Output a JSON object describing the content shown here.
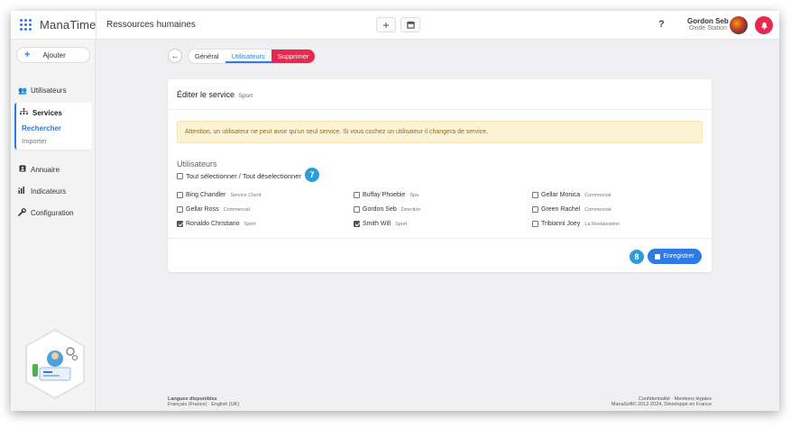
{
  "app": {
    "name": "ManaTime",
    "page_title": "Ressources humaines"
  },
  "topbar": {
    "add_icon": "+",
    "calendar_icon": "calendar-icon",
    "help": "?",
    "user_name": "Gordon Seb",
    "user_org": "Oxide Station"
  },
  "sidebar": {
    "add_label": "Ajouter",
    "items": [
      {
        "label": "Utilisateurs",
        "icon": "users-icon"
      },
      {
        "label": "Services",
        "icon": "sitemap-icon"
      },
      {
        "label": "Annuaire",
        "icon": "addressbook-icon"
      },
      {
        "label": "Indicateurs",
        "icon": "chart-icon"
      },
      {
        "label": "Configuration",
        "icon": "wrench-icon"
      }
    ],
    "services_sub": [
      "Rechercher",
      "Importer"
    ]
  },
  "tabs": [
    {
      "label": "Général"
    },
    {
      "label": "Utilisateurs"
    },
    {
      "label": "Supprimer"
    }
  ],
  "card": {
    "title": "Éditer le service",
    "service_name": "Sport",
    "alert": "Attention, un utilisateur ne peut avoir qu'un seul service. Si vous cochez un utilisateur il changera de service.",
    "users_heading": "Utilisateurs",
    "select_all": "Tout sélectionner / Tout déselectionner",
    "badge_select": "7",
    "badge_save": "8",
    "save_label": "Enregistrer",
    "users": [
      {
        "name": "Bing Chandler",
        "service": "Service Client",
        "checked": false
      },
      {
        "name": "Buffay Phoebie",
        "service": "Spa",
        "checked": false
      },
      {
        "name": "Gellar Monica",
        "service": "Commercial",
        "checked": false
      },
      {
        "name": "Gellar Ross",
        "service": "Commercial",
        "checked": false
      },
      {
        "name": "Gordon Seb",
        "service": "Direction",
        "checked": false
      },
      {
        "name": "Green Rachel",
        "service": "Commercial",
        "checked": false
      },
      {
        "name": "Ronaldo Christiano",
        "service": "Sport",
        "checked": true
      },
      {
        "name": "Smith Will",
        "service": "Sport",
        "checked": true
      },
      {
        "name": "Tribianni Joey",
        "service": "La Restauration",
        "checked": false
      }
    ]
  },
  "footer": {
    "langs_title": "Langues disponibles",
    "langs": "Français (France) · English (UK)",
    "legal": "Confidentialité · Mentions légales",
    "copyright": "ManaSoft© 2012-2024, Développé en France"
  },
  "colors": {
    "primary": "#2d7be5",
    "danger": "#e8284d",
    "badge": "#2d9cdb",
    "alert_bg": "#fcf3d7"
  }
}
